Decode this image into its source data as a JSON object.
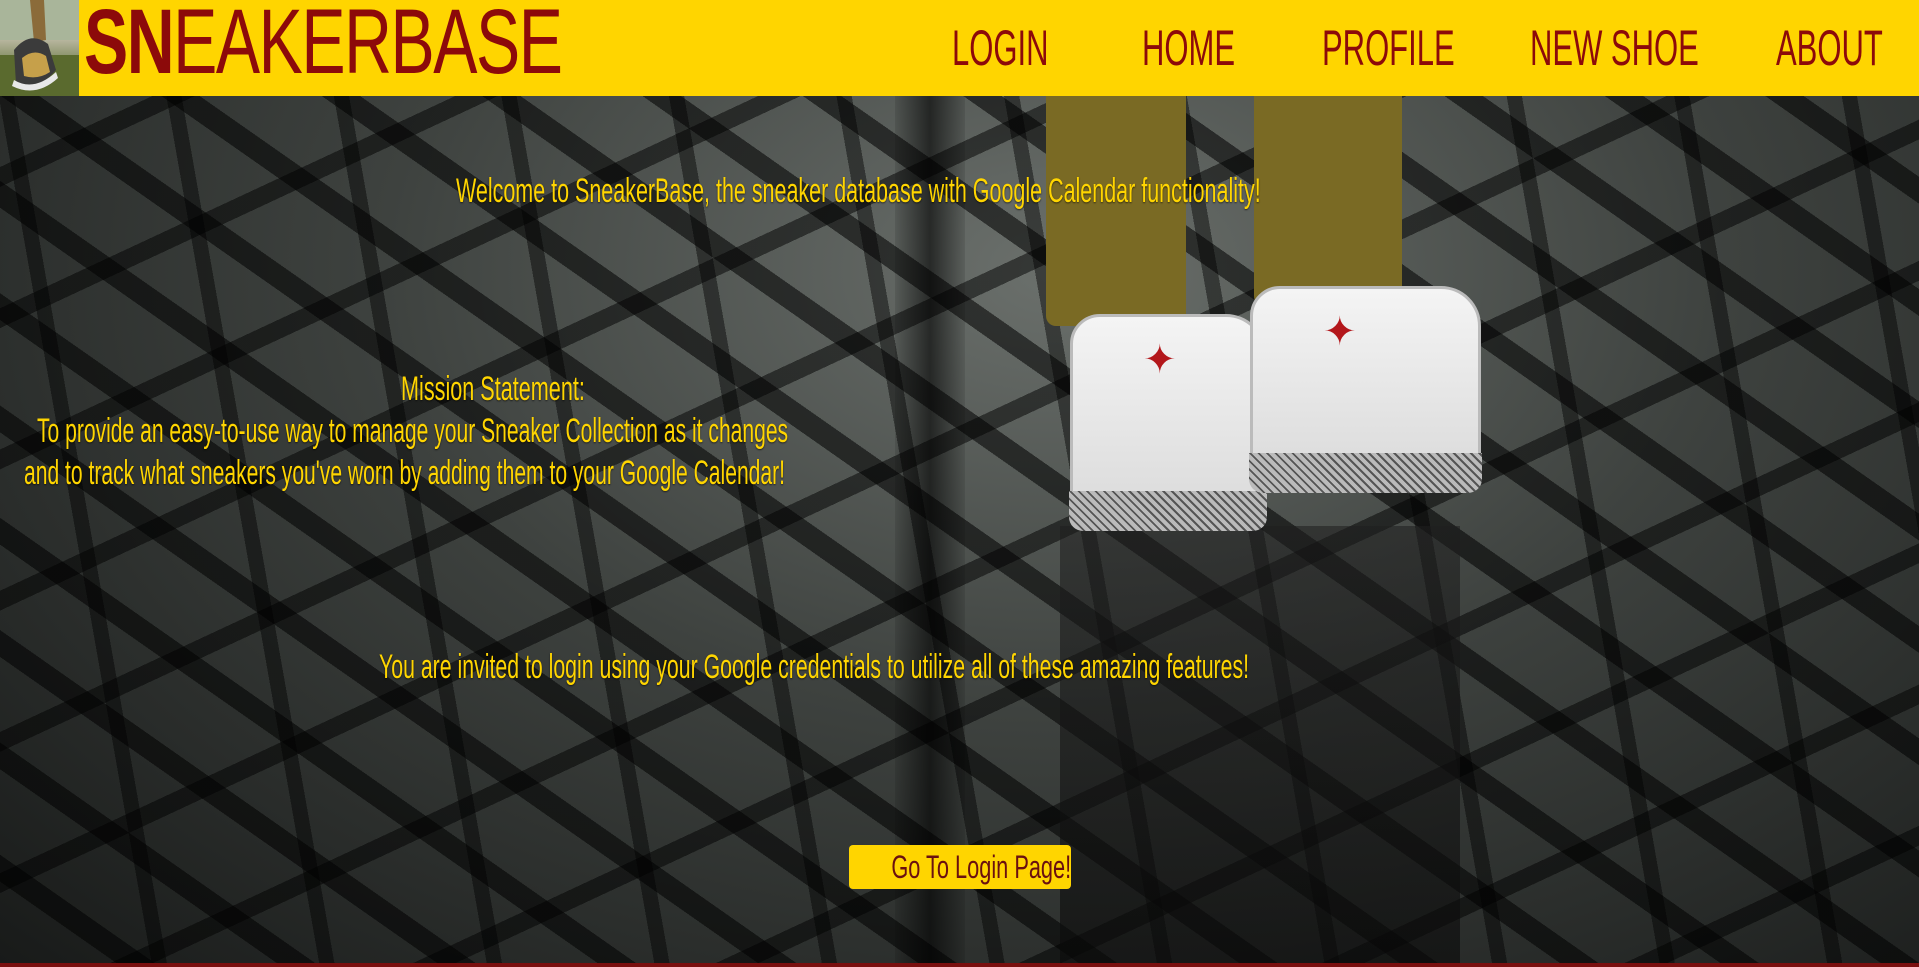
{
  "header": {
    "brand_bold": "SN",
    "brand_rest": "EAKERBASE",
    "nav": [
      "LOGIN",
      "HOME",
      "PROFILE",
      "NEW SHOE",
      "ABOUT"
    ]
  },
  "main": {
    "welcome": "Welcome to SneakerBase, the sneaker database with Google Calendar functionality!",
    "mission_title": "Mission Statement:",
    "mission_line1": "To provide an easy-to-use way to manage your Sneaker Collection as it changes",
    "mission_line2": "and to track what sneakers you've worn by adding them to your Google Calendar!",
    "invite": "You are invited to login using your Google credentials to utilize all of these amazing features!",
    "cta_label": "Go To Login Page!"
  },
  "colors": {
    "header_bg": "#ffd500",
    "brand_text": "#8c0a0a",
    "hero_text": "#ffd500"
  }
}
